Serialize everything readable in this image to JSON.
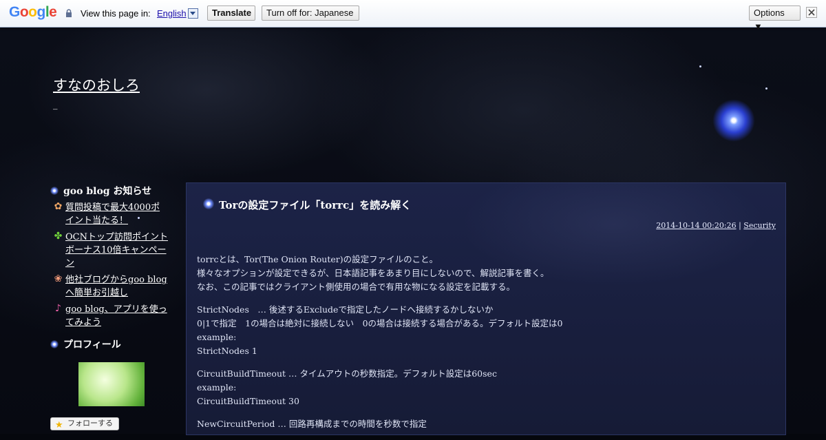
{
  "translate_bar": {
    "logo": "Google",
    "view_label": "View this page in:",
    "language": "English",
    "translate_button": "Translate",
    "turn_off_button": "Turn off for: Japanese",
    "options_button": "Options ▼"
  },
  "blog": {
    "title": "すなのおしろ",
    "subtitle": "_"
  },
  "sidebar": {
    "notice_heading": "goo blog お知らせ",
    "notices": [
      {
        "icon": "kitsune-icon",
        "text": "質問投稿で最大4000ポイント当たる！"
      },
      {
        "icon": "clover-icon",
        "text": "OCNトップ訪問ポイントボーナス10倍キャンペーン"
      },
      {
        "icon": "flower-icon",
        "text": "他社ブログからgoo blogへ簡単お引越し"
      },
      {
        "icon": "music-note-icon",
        "text": "goo blog、アプリを使ってみよう"
      }
    ],
    "profile_heading": "プロフィール",
    "follow_button": "フォローする"
  },
  "post": {
    "title": "Torの設定ファイル「torrc」を読み解く",
    "datetime": "2014-10-14 00:20:26",
    "separator": "|",
    "category": "Security",
    "paragraphs": [
      [
        "torrcとは、Tor(The Onion Router)の設定ファイルのこと。",
        "様々なオプションが設定できるが、日本語記事をあまり目にしないので、解説記事を書く。",
        "なお、この記事ではクライアント側使用の場合で有用な物になる設定を記載する。"
      ],
      [
        "StrictNodes　… 後述するExcludeで指定したノードへ接続するかしないか",
        "0|1で指定　1の場合は絶対に接続しない　0の場合は接続する場合がある。デフォルト設定は0",
        "example:",
        "StrictNodes 1"
      ],
      [
        "CircuitBuildTimeout … タイムアウトの秒数指定。デフォルト設定は60sec",
        "example:",
        "CircuitBuildTimeout 30"
      ],
      [
        "NewCircuitPeriod … 回路再構成までの時間を秒数で指定"
      ]
    ]
  },
  "colors": {
    "panel": "#1c2347",
    "background": "#070911",
    "link": "#ffffff"
  }
}
